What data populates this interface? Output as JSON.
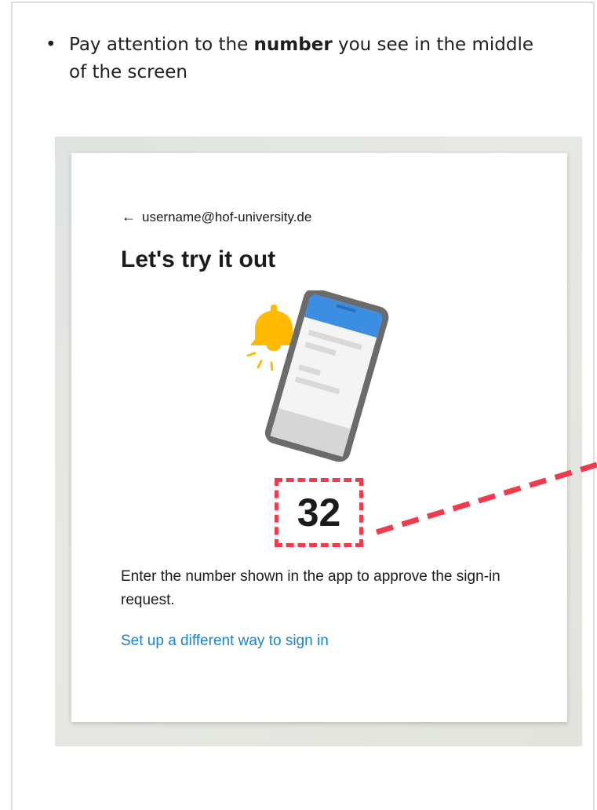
{
  "instruction": {
    "bullet": "•",
    "text_before": "Pay attention to the ",
    "emphasis": "number",
    "text_after": " you see in the middle of the screen"
  },
  "signin": {
    "back_arrow": "←",
    "account": "username@hof-university.de",
    "title": "Let's try it out",
    "number": "32",
    "description": "Enter the number shown in the app to approve the sign-in request.",
    "alt_link": "Set up a different way to sign in"
  },
  "colors": {
    "highlight": "#ef3b4c",
    "link": "#1a82d2",
    "bell": "#ffb900",
    "phone_header": "#3c8ee3"
  },
  "icons": {
    "back": "arrow-left-icon",
    "bell": "bell-icon",
    "phone": "phone-icon"
  }
}
